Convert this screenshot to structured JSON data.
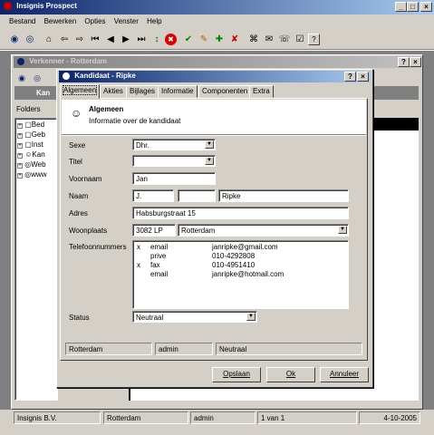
{
  "app": {
    "title": "Insignis Prospect",
    "menu": [
      "Bestand",
      "Bewerken",
      "Opties",
      "Venster",
      "Help"
    ],
    "caption_buttons": [
      "_",
      "□",
      "×"
    ]
  },
  "toolbar": {
    "icons": [
      "◉",
      "◎",
      "⌂",
      "⇦",
      "⇨",
      "⏮",
      "◀",
      "▶",
      "⏭",
      "↕",
      "✖",
      "✔",
      "✎",
      "✚",
      "✘",
      "⌘",
      "✉",
      "☏",
      "☑",
      "?"
    ]
  },
  "explorer": {
    "title": "Verkenner - Rotterdam",
    "band_text": "Kan",
    "folders_label": "Folders",
    "tree": [
      {
        "label": "Bed"
      },
      {
        "label": "Geb"
      },
      {
        "label": "Inst"
      },
      {
        "label": "Kan"
      },
      {
        "label": "Web"
      },
      {
        "label": "www"
      }
    ],
    "help_btn": "?",
    "close_btn": "×"
  },
  "dialog": {
    "title": "Kandidaat - Ripke",
    "help_btn": "?",
    "close_btn": "×",
    "tabs": [
      "Algemeen",
      "Akties",
      "Bijlages",
      "Informatie",
      "Componenten",
      "Extra"
    ],
    "section_title": "Algemeen",
    "section_subtitle": "Informatie over de kandidaat",
    "form": {
      "sexe_label": "Sexe",
      "sexe_value": "Dhr.",
      "titel_label": "Titel",
      "titel_value": "",
      "voornaam_label": "Voornaam",
      "voornaam_value": "Jan",
      "naam_label": "Naam",
      "naam_initials": "J.",
      "naam_middle": "",
      "naam_last": "Ripke",
      "adres_label": "Adres",
      "adres_value": "Habsburgstraat 15",
      "woonplaats_label": "Woonplaats",
      "postcode_value": "3082 LP",
      "city_value": "Rotterdam",
      "telefoon_label": "Telefoonnummers",
      "phones": [
        {
          "mark": "x",
          "type": "email",
          "value": "janripke@gmail.com"
        },
        {
          "mark": "",
          "type": "prive",
          "value": "010-4292808"
        },
        {
          "mark": "x",
          "type": "fax",
          "value": "010-4951410"
        },
        {
          "mark": "",
          "type": "email",
          "value": "janripke@hotmail.com"
        }
      ],
      "status_label": "Status",
      "status_value": "Neutraal"
    },
    "info_bar": [
      "Rotterdam",
      "admin",
      "Neutraal"
    ],
    "buttons": {
      "save": "Opslaan",
      "ok": "Ok",
      "cancel": "Annuleer"
    }
  },
  "statusbar": [
    "Insignis B.V.",
    "Rotterdam",
    "admin",
    "1 van 1",
    "4-10-2005"
  ]
}
